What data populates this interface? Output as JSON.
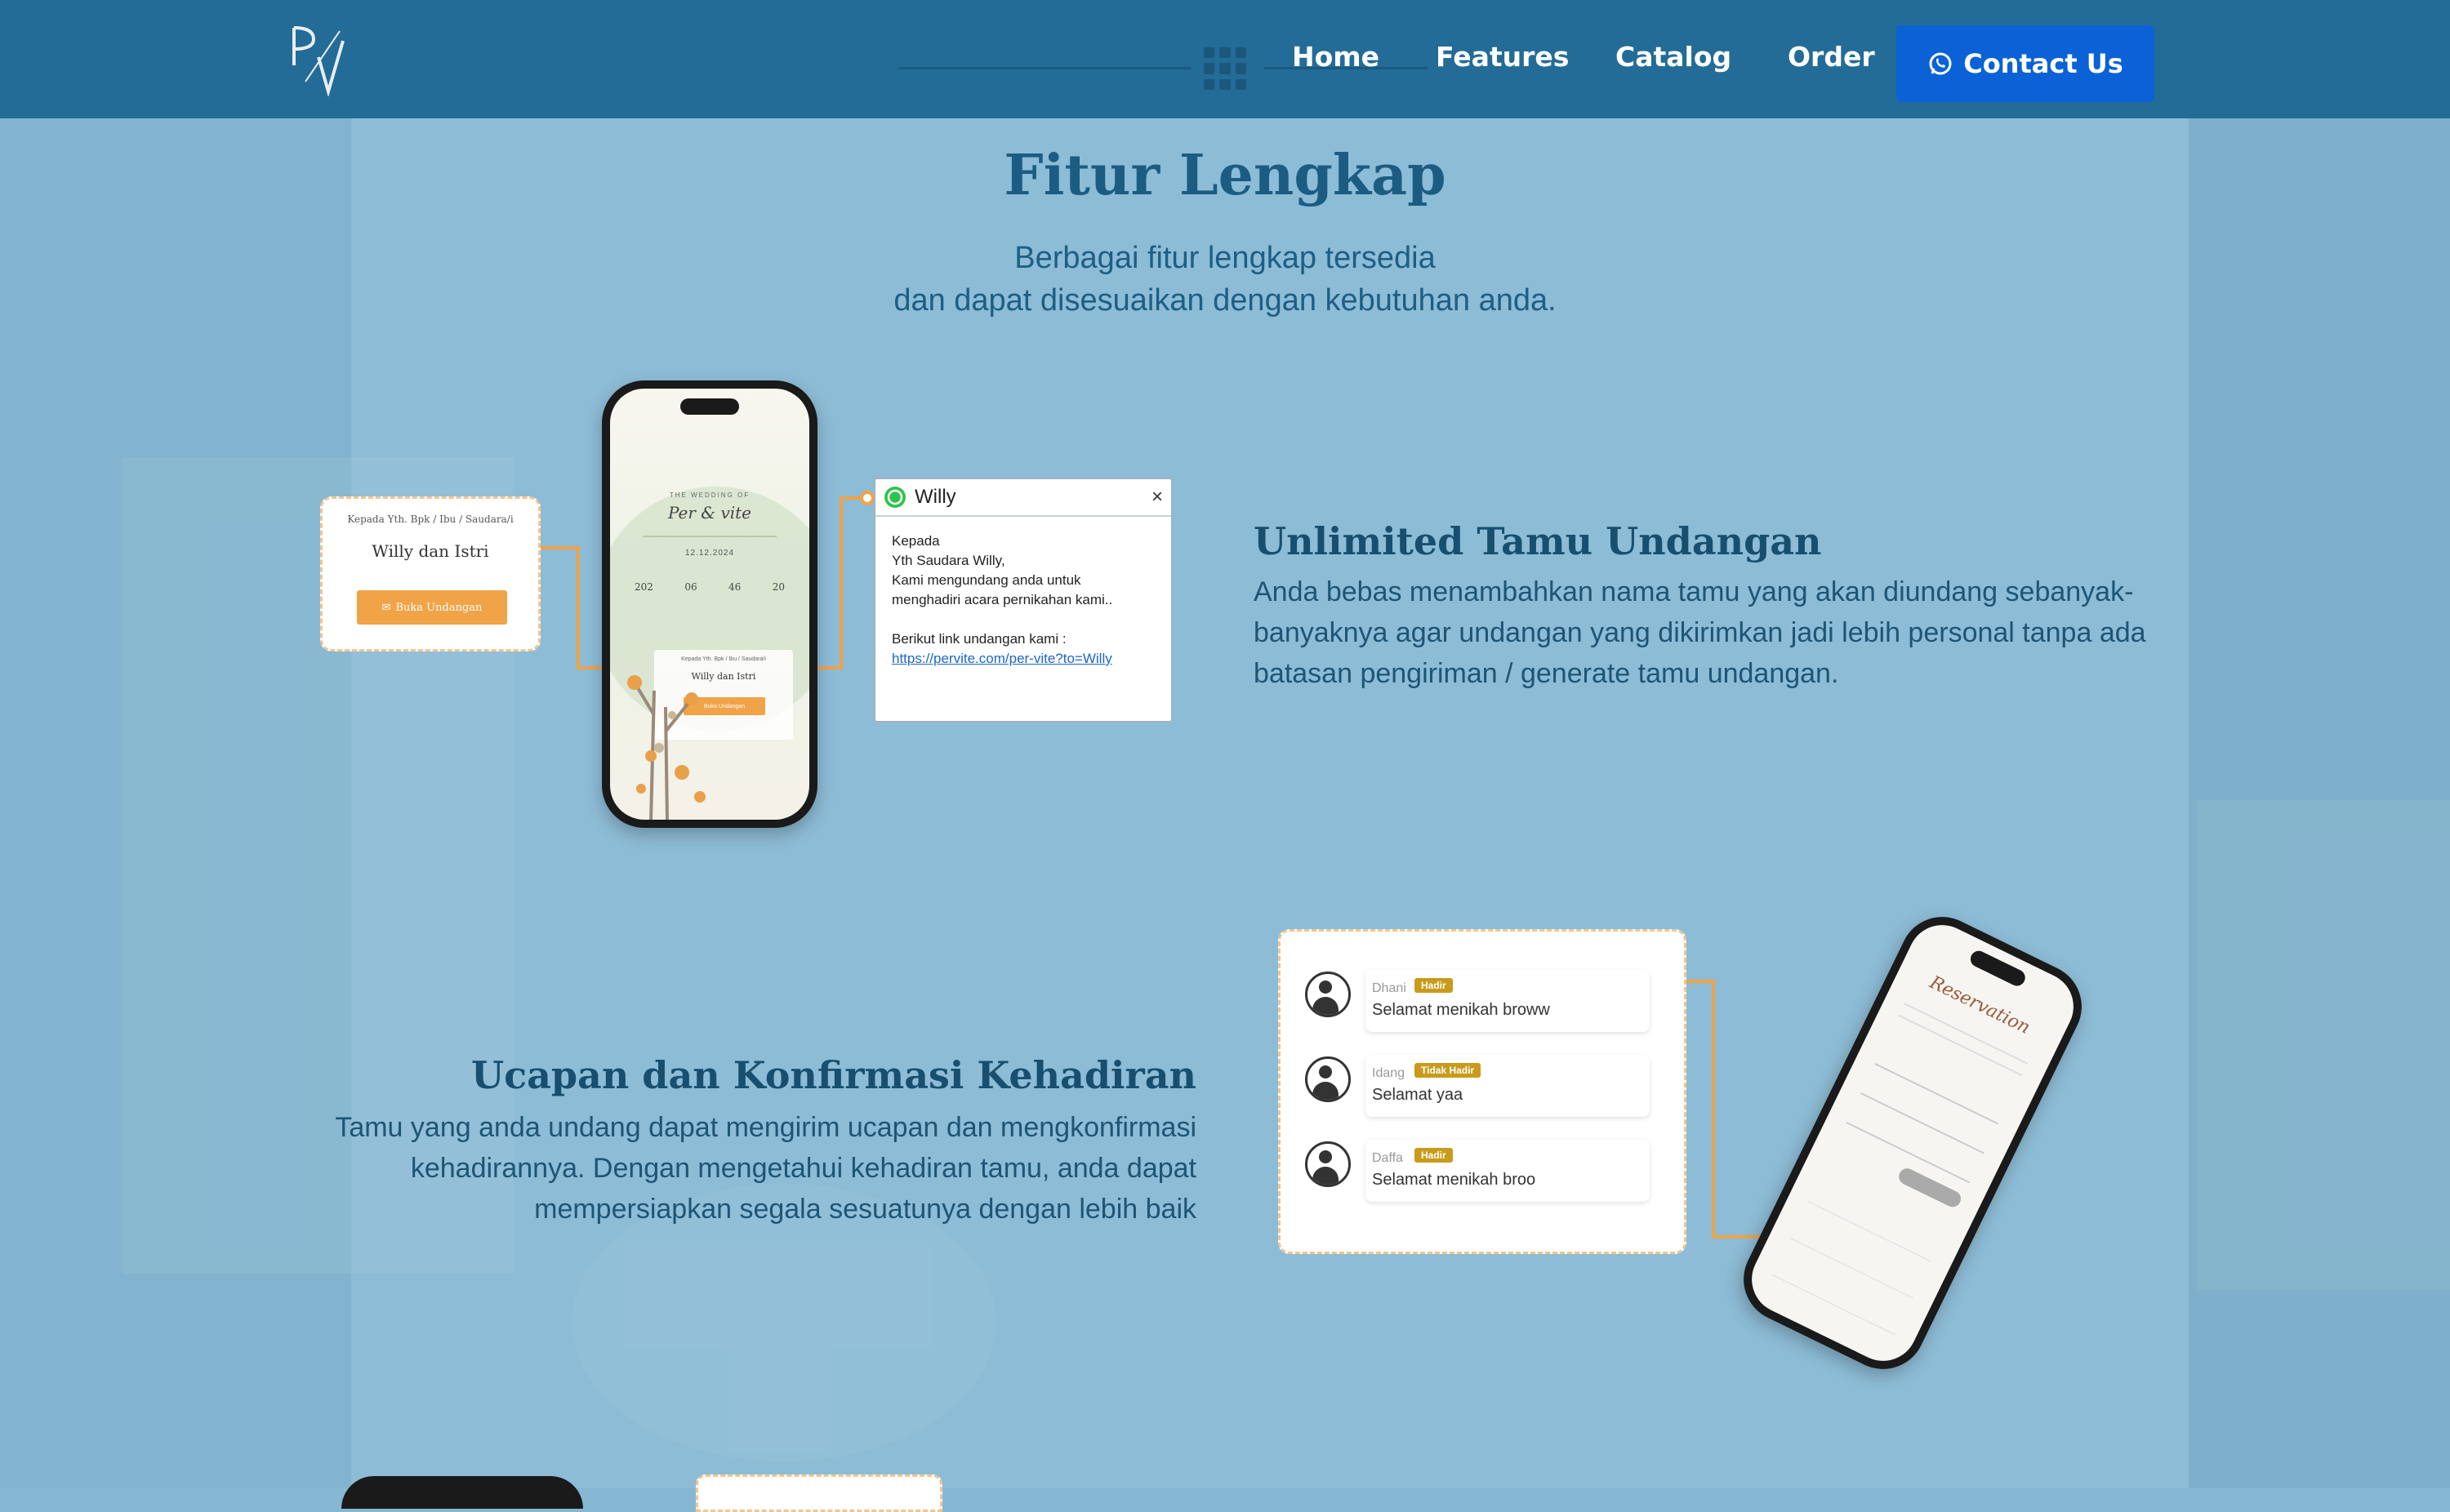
{
  "nav": {
    "logo_alt": "Per Vite logo",
    "items": [
      "Home",
      "Features",
      "Catalog",
      "Order"
    ],
    "contact_label": "Contact Us"
  },
  "section": {
    "title": "Fitur Lengkap",
    "subtitle_line1": "Berbagai fitur lengkap tersedia",
    "subtitle_line2": "dan dapat disesuaikan dengan kebutuhan anda."
  },
  "feature1": {
    "title": "Unlimited Tamu Undangan",
    "desc_line1": "Anda bebas menambahkan nama tamu yang akan diundang sebanyak-",
    "desc_line2": "banyaknya agar undangan yang dikirimkan jadi lebih personal tanpa ada",
    "desc_line3": "batasan pengiriman / generate tamu undangan.",
    "card": {
      "to_label": "Kepada Yth. Bpk / Ibu / Saudara/i",
      "guest": "Willy dan Istri",
      "button": "Buka Undangan"
    },
    "phone": {
      "heading": "THE WEDDING OF",
      "couple": "Per & vite",
      "date": "12.12.2024",
      "countdown": [
        "202",
        "06",
        "46",
        "20"
      ],
      "to_label": "Kepada Yth. Bpk / Ibu / Saudara/i",
      "guest": "Willy dan Istri",
      "button": "Buka Undangan"
    },
    "whatsapp": {
      "contact": "Willy",
      "close": "×",
      "line1": "Kepada",
      "line2": "Yth Saudara Willy,",
      "line3": "Kami mengundang anda untuk",
      "line4": "menghadiri acara pernikahan kami..",
      "line5": "Berikut link undangan kami :",
      "link": "https://pervite.com/per-vite?to=Willy"
    }
  },
  "feature2": {
    "title": "Ucapan dan Konfirmasi Kehadiran",
    "desc_line1": "Tamu yang anda undang dapat mengirim ucapan dan mengkonfirmasi",
    "desc_line2": "kehadirannya. Dengan mengetahui kehadiran tamu, anda dapat",
    "desc_line3": "mempersiapkan segala sesuatunya dengan lebih baik",
    "guests": [
      {
        "name": "Dhani",
        "status": "Hadir",
        "message": "Selamat menikah broww"
      },
      {
        "name": "Idang",
        "status": "Tidak Hadir",
        "message": "Selamat yaa"
      },
      {
        "name": "Daffa",
        "status": "Hadir",
        "message": "Selamat menikah broo"
      }
    ],
    "phone": {
      "heading": "Reservation"
    }
  },
  "colors": {
    "header": "#236c97",
    "contact_button": "#0a62d6",
    "page_bg": "#86b8d3",
    "accent_orange": "#f0a347"
  }
}
